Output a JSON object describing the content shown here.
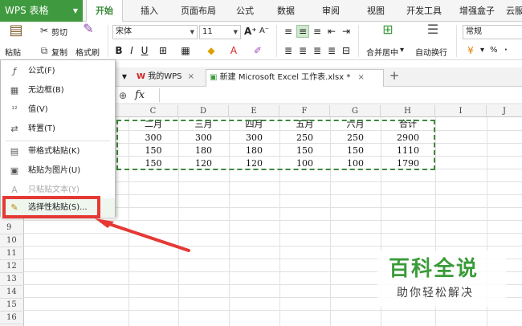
{
  "menubar": {
    "app_name": "WPS 表格",
    "tabs": [
      "开始",
      "插入",
      "页面布局",
      "公式",
      "数据",
      "审阅",
      "视图",
      "开发工具",
      "增强盒子",
      "云服"
    ],
    "active_tab": "开始"
  },
  "ribbon": {
    "paste_label": "粘贴",
    "cut_label": "剪切",
    "copy_label": "复制",
    "format_painter_label": "格式刷",
    "font_name": "宋体",
    "font_size": "11",
    "merge_center_label": "合并居中",
    "wrap_text_label": "自动换行",
    "number_format": "常规",
    "percent_symbol": "%",
    "comma_symbol": "·"
  },
  "tabstrip": {
    "tabs": [
      {
        "label": "我的WPS",
        "close": "×"
      },
      {
        "label": "新建 Microsoft Excel 工作表.xlsx *",
        "close": "×"
      }
    ],
    "new_tab": "+"
  },
  "formula_bar": {
    "fx_label": "fx"
  },
  "sheet": {
    "columns": [
      "C",
      "D",
      "E",
      "F",
      "G",
      "H",
      "I",
      "J"
    ],
    "rows": [
      "9",
      "10",
      "11",
      "12",
      "13",
      "14",
      "15",
      "16"
    ],
    "header_row": [
      "二月",
      "三月",
      "四月",
      "五月",
      "六月",
      "合计"
    ],
    "data_rows": [
      [
        "300",
        "300",
        "300",
        "250",
        "250",
        "2900"
      ],
      [
        "150",
        "180",
        "180",
        "150",
        "150",
        "1110"
      ],
      [
        "150",
        "120",
        "120",
        "100",
        "100",
        "1790"
      ]
    ]
  },
  "paste_menu": {
    "items": [
      {
        "label": "公式(F)",
        "icon": "formula-icon",
        "glyph": "ƒ",
        "disabled": false
      },
      {
        "label": "无边框(B)",
        "icon": "no-border-icon",
        "glyph": "▦",
        "disabled": false
      },
      {
        "label": "值(V)",
        "icon": "values-icon",
        "glyph": "¹²",
        "disabled": false
      },
      {
        "label": "转置(T)",
        "icon": "transpose-icon",
        "glyph": "⇄",
        "disabled": false
      },
      {
        "label": "带格式粘贴(K)",
        "icon": "paste-format-icon",
        "glyph": "▤",
        "disabled": false
      },
      {
        "label": "粘贴为图片(U)",
        "icon": "paste-picture-icon",
        "glyph": "▣",
        "disabled": false
      },
      {
        "label": "只粘贴文本(Y)",
        "icon": "paste-text-icon",
        "glyph": "A",
        "disabled": true
      },
      {
        "label": "选择性粘贴(S)...",
        "icon": "paste-special-icon",
        "glyph": "✎",
        "disabled": false
      }
    ]
  },
  "watermark": {
    "title": "百科全说",
    "subtitle": "助你轻松解决"
  },
  "colors": {
    "brand_green": "#3f9a3f",
    "highlight_red": "#e53935",
    "marquee_green": "#3e8a3e"
  }
}
